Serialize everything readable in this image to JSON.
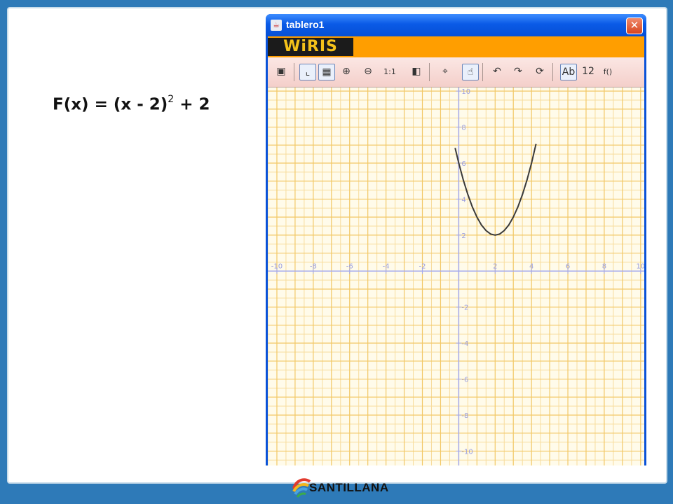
{
  "slide": {
    "formula": {
      "base": "F(x) = (x - 2)",
      "exponent": "2",
      "tail": " + 2"
    }
  },
  "window": {
    "title": "tablero1",
    "close_glyph": "✕",
    "brand": "WiRIS",
    "toolbar": [
      {
        "name": "save-icon",
        "glyph": "▣"
      },
      {
        "name": "axes-icon",
        "glyph": "⌞",
        "active": true
      },
      {
        "name": "grid-icon",
        "glyph": "▦",
        "active": true
      },
      {
        "name": "zoom-in-icon",
        "glyph": "⊕"
      },
      {
        "name": "zoom-out-icon",
        "glyph": "⊖"
      },
      {
        "name": "zoom-reset",
        "glyph": "1:1"
      },
      {
        "name": "contrast-icon",
        "glyph": "◧"
      },
      {
        "name": "target-icon",
        "glyph": "⌖"
      },
      {
        "name": "pointer-icon",
        "glyph": "☝",
        "active": true
      },
      {
        "name": "rotate-left-icon",
        "glyph": "↶"
      },
      {
        "name": "rotate-right-icon",
        "glyph": "↷"
      },
      {
        "name": "refresh-icon",
        "glyph": "⟳"
      },
      {
        "name": "text-style-icon",
        "glyph": "Ab",
        "active": true
      },
      {
        "name": "number-icon",
        "glyph": "12"
      },
      {
        "name": "function-icon",
        "glyph": "f()"
      }
    ]
  },
  "footer": {
    "brand": "SANTILLANA"
  },
  "chart_data": {
    "type": "line",
    "x_ticks": [
      "-10",
      "-8",
      "-6",
      "-4",
      "-2",
      "2",
      "4",
      "6",
      "8",
      "10"
    ],
    "y_ticks": [
      "10",
      "8",
      "6",
      "4",
      "2",
      "-2",
      "-4",
      "-6",
      "-8",
      "-10"
    ],
    "xlim": [
      -10.5,
      10.2
    ],
    "ylim": [
      -10.8,
      10.2
    ],
    "grid": true,
    "function": "(x-2)^2+2",
    "series": [
      {
        "x": [
          -0.2,
          0,
          0.25,
          0.5,
          0.75,
          1,
          1.25,
          1.5,
          1.75,
          2,
          2.25,
          2.5,
          2.75,
          3,
          3.25,
          3.5,
          3.75,
          4,
          4.25
        ],
        "y": [
          6.84,
          6,
          5.06,
          4.25,
          3.56,
          3,
          2.56,
          2.25,
          2.06,
          2,
          2.06,
          2.25,
          2.56,
          3,
          3.56,
          4.25,
          5.06,
          6,
          7.06
        ]
      }
    ],
    "colors": {
      "grid_major": "#f2c866",
      "grid_minor": "#f7dc9c",
      "axis": "#a3a9ee",
      "curve": "#3a3a3a",
      "tick_text": "#9a9ee0"
    }
  }
}
